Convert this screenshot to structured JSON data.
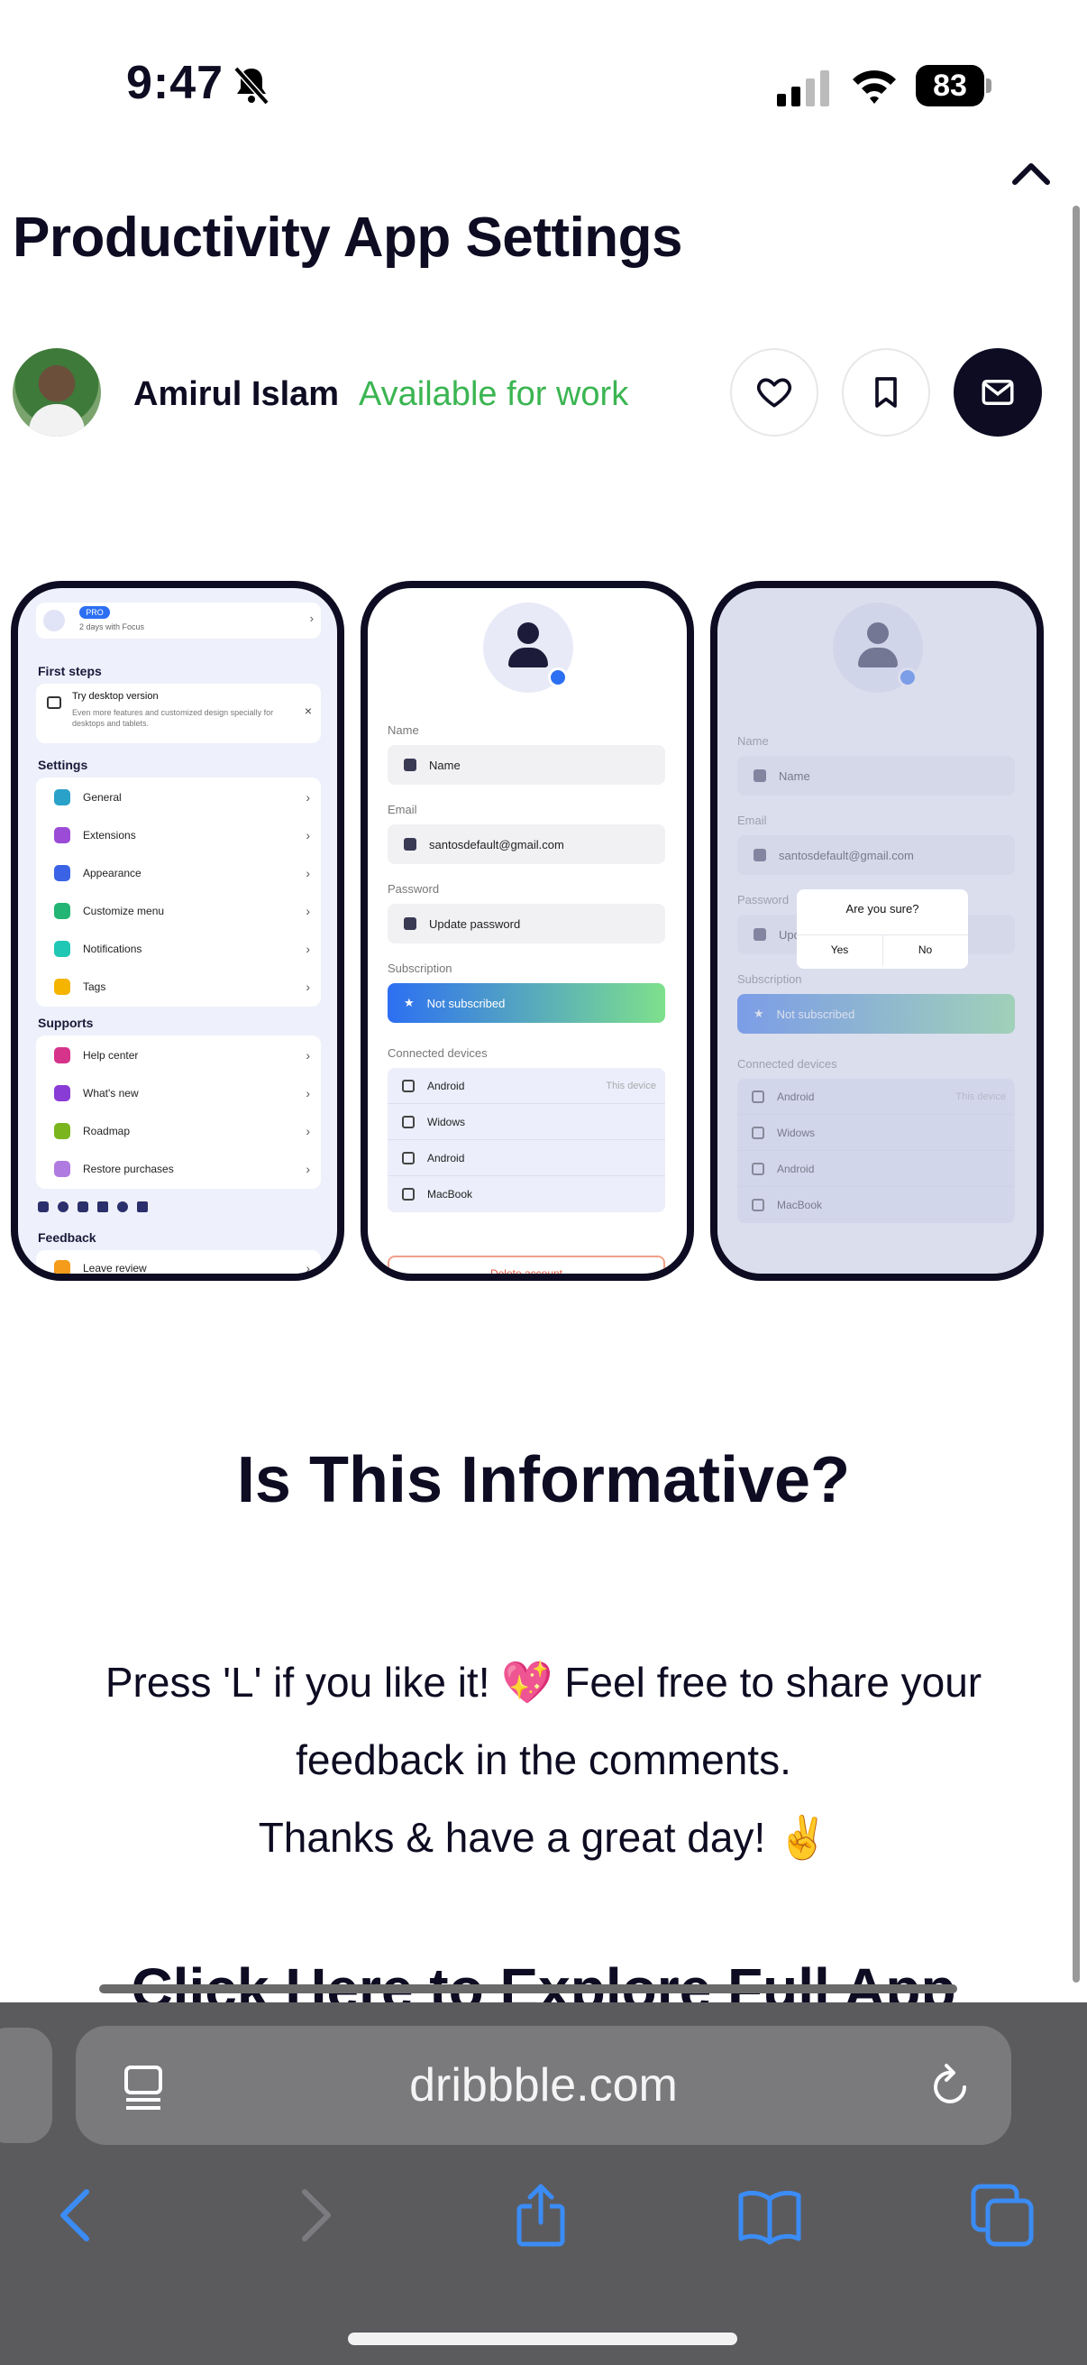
{
  "status_bar": {
    "time": "9:47",
    "battery": "83",
    "icons": [
      "bell-slash-icon",
      "signal-icon",
      "wifi-icon",
      "battery-icon"
    ]
  },
  "shot": {
    "title": "Productivity App Settings",
    "author": "Amirul Islam",
    "availability": "Available for work",
    "actions": [
      "like",
      "save",
      "message"
    ]
  },
  "mockup1": {
    "header_sub": "2 days with Focus",
    "pro_badge": "PRO",
    "first_steps": "First steps",
    "desktop_title": "Try desktop version",
    "desktop_desc": "Even more features and customized design specially for desktops and tablets.",
    "settings": "Settings",
    "settings_items": [
      "General",
      "Extensions",
      "Appearance",
      "Customize menu",
      "Notifications",
      "Tags"
    ],
    "supports": "Supports",
    "support_items": [
      "Help center",
      "What's new",
      "Roadmap",
      "Restore purchases"
    ],
    "feedback": "Feedback",
    "feedback_items": [
      "Leave review"
    ]
  },
  "mockup2": {
    "name_label": "Name",
    "name_value": "Name",
    "email_label": "Email",
    "email_value": "santosdefault@gmail.com",
    "password_label": "Password",
    "password_value": "Update password",
    "subscription_label": "Subscription",
    "subscription_value": "Not subscribed",
    "devices_label": "Connected devices",
    "devices": [
      "Android",
      "Widows",
      "Android",
      "MacBook"
    ],
    "this_device": "This device",
    "delete": "Delete account"
  },
  "mockup3": {
    "dialog_title": "Are you sure?",
    "yes": "Yes",
    "no": "No"
  },
  "content": {
    "heading": "Is This Informative?",
    "line1": "Press 'L' if you like it! 💖 Feel free to share your",
    "line2": "feedback in the comments.",
    "line3": "Thanks & have a great day! ✌️",
    "cta": "Click Here to Explore Full App"
  },
  "browser": {
    "url": "dribbble.com"
  },
  "colors": {
    "ink": "#0d0c22",
    "available": "#3bb552",
    "browser_bar": "#5b5b5e",
    "accent_blue": "#2d6ff2"
  }
}
